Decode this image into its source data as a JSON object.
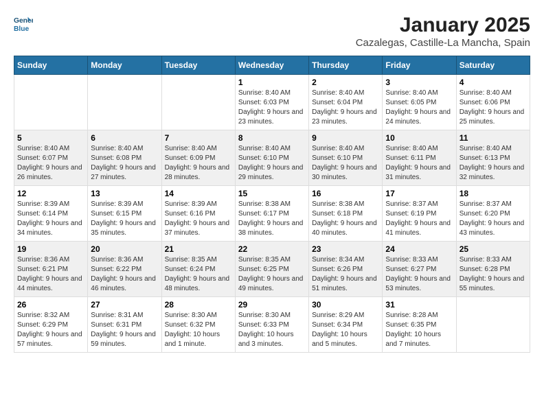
{
  "header": {
    "logo_line1": "General",
    "logo_line2": "Blue",
    "title": "January 2025",
    "subtitle": "Cazalegas, Castille-La Mancha, Spain"
  },
  "weekdays": [
    "Sunday",
    "Monday",
    "Tuesday",
    "Wednesday",
    "Thursday",
    "Friday",
    "Saturday"
  ],
  "weeks": [
    [
      {
        "day": "",
        "text": ""
      },
      {
        "day": "",
        "text": ""
      },
      {
        "day": "",
        "text": ""
      },
      {
        "day": "1",
        "text": "Sunrise: 8:40 AM\nSunset: 6:03 PM\nDaylight: 9 hours and 23 minutes."
      },
      {
        "day": "2",
        "text": "Sunrise: 8:40 AM\nSunset: 6:04 PM\nDaylight: 9 hours and 23 minutes."
      },
      {
        "day": "3",
        "text": "Sunrise: 8:40 AM\nSunset: 6:05 PM\nDaylight: 9 hours and 24 minutes."
      },
      {
        "day": "4",
        "text": "Sunrise: 8:40 AM\nSunset: 6:06 PM\nDaylight: 9 hours and 25 minutes."
      }
    ],
    [
      {
        "day": "5",
        "text": "Sunrise: 8:40 AM\nSunset: 6:07 PM\nDaylight: 9 hours and 26 minutes."
      },
      {
        "day": "6",
        "text": "Sunrise: 8:40 AM\nSunset: 6:08 PM\nDaylight: 9 hours and 27 minutes."
      },
      {
        "day": "7",
        "text": "Sunrise: 8:40 AM\nSunset: 6:09 PM\nDaylight: 9 hours and 28 minutes."
      },
      {
        "day": "8",
        "text": "Sunrise: 8:40 AM\nSunset: 6:10 PM\nDaylight: 9 hours and 29 minutes."
      },
      {
        "day": "9",
        "text": "Sunrise: 8:40 AM\nSunset: 6:10 PM\nDaylight: 9 hours and 30 minutes."
      },
      {
        "day": "10",
        "text": "Sunrise: 8:40 AM\nSunset: 6:11 PM\nDaylight: 9 hours and 31 minutes."
      },
      {
        "day": "11",
        "text": "Sunrise: 8:40 AM\nSunset: 6:13 PM\nDaylight: 9 hours and 32 minutes."
      }
    ],
    [
      {
        "day": "12",
        "text": "Sunrise: 8:39 AM\nSunset: 6:14 PM\nDaylight: 9 hours and 34 minutes."
      },
      {
        "day": "13",
        "text": "Sunrise: 8:39 AM\nSunset: 6:15 PM\nDaylight: 9 hours and 35 minutes."
      },
      {
        "day": "14",
        "text": "Sunrise: 8:39 AM\nSunset: 6:16 PM\nDaylight: 9 hours and 37 minutes."
      },
      {
        "day": "15",
        "text": "Sunrise: 8:38 AM\nSunset: 6:17 PM\nDaylight: 9 hours and 38 minutes."
      },
      {
        "day": "16",
        "text": "Sunrise: 8:38 AM\nSunset: 6:18 PM\nDaylight: 9 hours and 40 minutes."
      },
      {
        "day": "17",
        "text": "Sunrise: 8:37 AM\nSunset: 6:19 PM\nDaylight: 9 hours and 41 minutes."
      },
      {
        "day": "18",
        "text": "Sunrise: 8:37 AM\nSunset: 6:20 PM\nDaylight: 9 hours and 43 minutes."
      }
    ],
    [
      {
        "day": "19",
        "text": "Sunrise: 8:36 AM\nSunset: 6:21 PM\nDaylight: 9 hours and 44 minutes."
      },
      {
        "day": "20",
        "text": "Sunrise: 8:36 AM\nSunset: 6:22 PM\nDaylight: 9 hours and 46 minutes."
      },
      {
        "day": "21",
        "text": "Sunrise: 8:35 AM\nSunset: 6:24 PM\nDaylight: 9 hours and 48 minutes."
      },
      {
        "day": "22",
        "text": "Sunrise: 8:35 AM\nSunset: 6:25 PM\nDaylight: 9 hours and 49 minutes."
      },
      {
        "day": "23",
        "text": "Sunrise: 8:34 AM\nSunset: 6:26 PM\nDaylight: 9 hours and 51 minutes."
      },
      {
        "day": "24",
        "text": "Sunrise: 8:33 AM\nSunset: 6:27 PM\nDaylight: 9 hours and 53 minutes."
      },
      {
        "day": "25",
        "text": "Sunrise: 8:33 AM\nSunset: 6:28 PM\nDaylight: 9 hours and 55 minutes."
      }
    ],
    [
      {
        "day": "26",
        "text": "Sunrise: 8:32 AM\nSunset: 6:29 PM\nDaylight: 9 hours and 57 minutes."
      },
      {
        "day": "27",
        "text": "Sunrise: 8:31 AM\nSunset: 6:31 PM\nDaylight: 9 hours and 59 minutes."
      },
      {
        "day": "28",
        "text": "Sunrise: 8:30 AM\nSunset: 6:32 PM\nDaylight: 10 hours and 1 minute."
      },
      {
        "day": "29",
        "text": "Sunrise: 8:30 AM\nSunset: 6:33 PM\nDaylight: 10 hours and 3 minutes."
      },
      {
        "day": "30",
        "text": "Sunrise: 8:29 AM\nSunset: 6:34 PM\nDaylight: 10 hours and 5 minutes."
      },
      {
        "day": "31",
        "text": "Sunrise: 8:28 AM\nSunset: 6:35 PM\nDaylight: 10 hours and 7 minutes."
      },
      {
        "day": "",
        "text": ""
      }
    ]
  ]
}
